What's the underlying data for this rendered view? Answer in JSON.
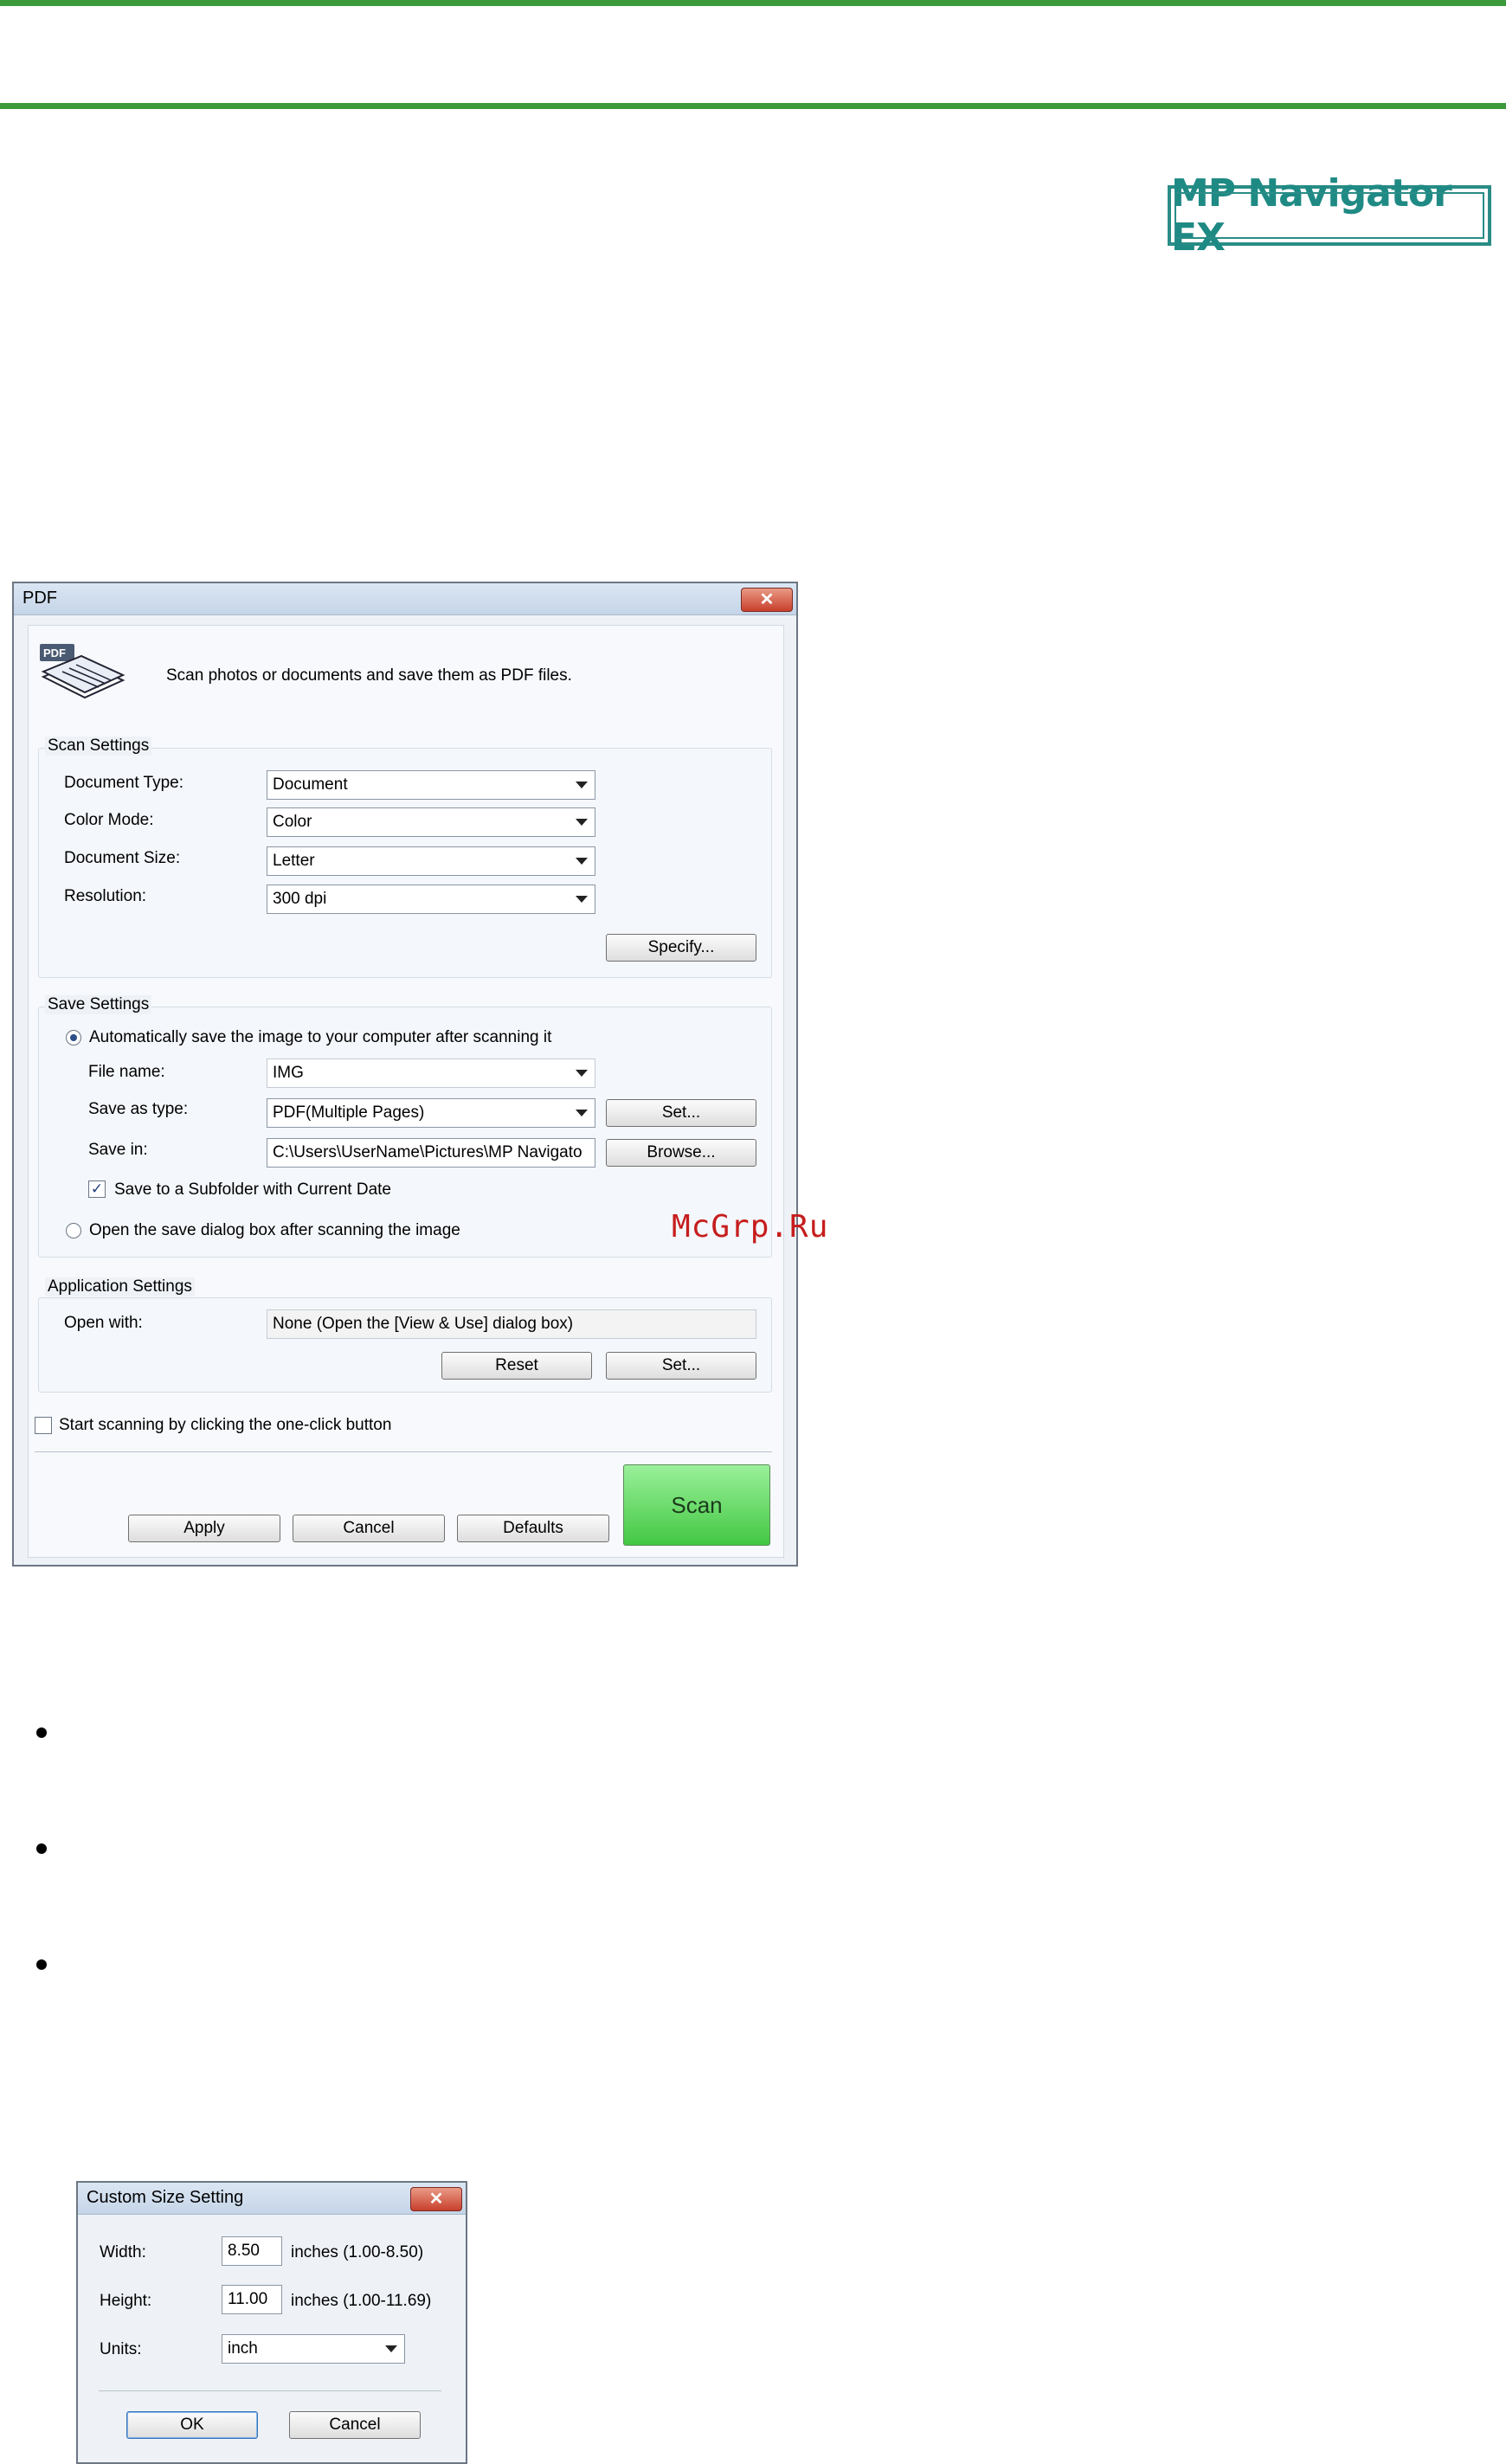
{
  "brand": {
    "logo_text": "MP Navigator EX"
  },
  "pdf_dialog": {
    "title": "PDF",
    "description": "Scan photos or documents and save them as PDF files.",
    "scan_settings": {
      "group_label": "Scan Settings",
      "document_type_label": "Document Type:",
      "document_type_value": "Document",
      "color_mode_label": "Color Mode:",
      "color_mode_value": "Color",
      "document_size_label": "Document Size:",
      "document_size_value": "Letter",
      "resolution_label": "Resolution:",
      "resolution_value": "300 dpi",
      "specify_button": "Specify..."
    },
    "save_settings": {
      "group_label": "Save Settings",
      "auto_save_option": "Automatically save the image to your computer after scanning it",
      "file_name_label": "File name:",
      "file_name_value": "IMG",
      "save_as_type_label": "Save as type:",
      "save_as_type_value": "PDF(Multiple Pages)",
      "set_button": "Set...",
      "save_in_label": "Save in:",
      "save_in_value": "C:\\Users\\UserName\\Pictures\\MP Navigato",
      "browse_button": "Browse...",
      "subfolder_option": "Save to a Subfolder with Current Date",
      "open_dialog_option": "Open the save dialog box after scanning the image"
    },
    "application_settings": {
      "group_label": "Application Settings",
      "open_with_label": "Open with:",
      "open_with_value": "None (Open the [View & Use] dialog box)",
      "reset_button": "Reset",
      "set_button": "Set..."
    },
    "one_click_option": "Start scanning by clicking the one-click button",
    "apply_button": "Apply",
    "cancel_button": "Cancel",
    "defaults_button": "Defaults",
    "scan_button": "Scan"
  },
  "watermark": "McGrp.Ru",
  "custom_size_dialog": {
    "title": "Custom Size Setting",
    "width_label": "Width:",
    "width_value": "8.50",
    "width_range": "inches (1.00-8.50)",
    "height_label": "Height:",
    "height_value": "11.00",
    "height_range": "inches (1.00-11.69)",
    "units_label": "Units:",
    "units_value": "inch",
    "ok_button": "OK",
    "cancel_button": "Cancel"
  },
  "colors": {
    "rule_green": "#3c9a3c",
    "logo_teal": "#1f8a84",
    "scan_green": "#43c843",
    "watermark_red": "#c61d1d"
  }
}
